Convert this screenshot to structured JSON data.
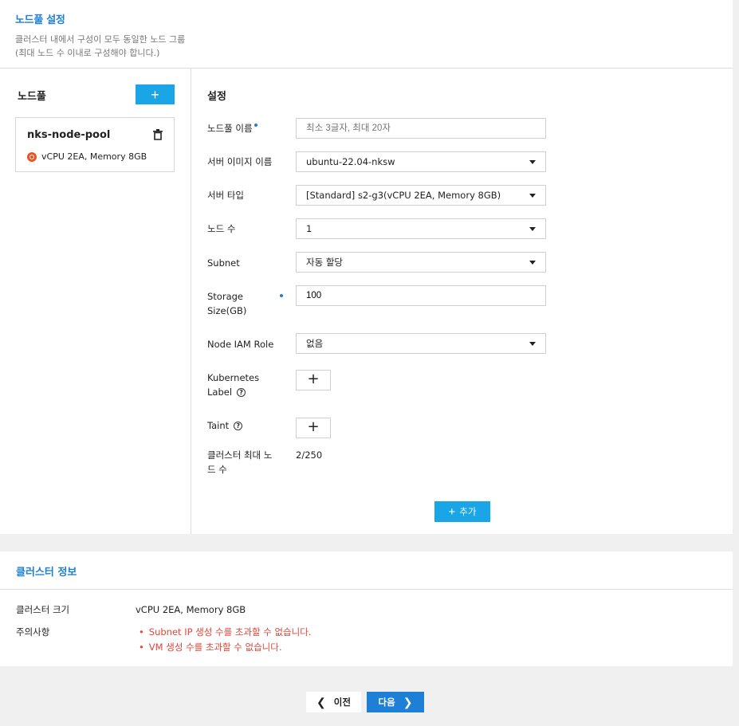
{
  "header": {
    "title": "노드풀 설정",
    "desc_line1": "클러스터 내에서 구성이 모두 동일한 노드 그룹",
    "desc_line2": "(최대 노드 수 이내로 구성해야 합니다.)"
  },
  "nodepool_panel": {
    "title": "노드풀",
    "add_label": "+",
    "pools": [
      {
        "name": "nks-node-pool",
        "spec": "vCPU 2EA, Memory 8GB",
        "os_icon": "ubuntu-icon"
      }
    ]
  },
  "settings": {
    "title": "설정",
    "nodepool_name": {
      "label": "노드풀 이름",
      "placeholder": "최소 3글자, 최대 20자"
    },
    "server_image": {
      "label": "서버 이미지 이름",
      "value": "ubuntu-22.04-nksw"
    },
    "server_type": {
      "label": "서버 타입",
      "value": "[Standard] s2-g3(vCPU 2EA, Memory 8GB)"
    },
    "node_count": {
      "label": "노드 수",
      "value": "1"
    },
    "subnet": {
      "label": "Subnet",
      "value": "자동 할당"
    },
    "storage": {
      "label_line1": "Storage",
      "label_line2": "Size(GB)",
      "value": "100"
    },
    "iam_role": {
      "label": "Node IAM Role",
      "value": "없음"
    },
    "k8s_label": {
      "label_line1": "Kubernetes",
      "label_line2": "Label",
      "add": "+"
    },
    "taint": {
      "label": "Taint",
      "add": "+"
    },
    "max_nodes": {
      "label_line1": "클러스터 최대 노",
      "label_line2": "드 수",
      "value": "2/250"
    },
    "add_button": {
      "icon": "+",
      "label": "추가"
    }
  },
  "cluster_info": {
    "title": "클러스터 정보",
    "size_label": "클러스터 크기",
    "size_value": "vCPU 2EA, Memory 8GB",
    "notice_label": "주의사항",
    "warnings": [
      "Subnet IP 생성 수를 초과할 수 없습니다.",
      "VM 생성 수를 초과할 수 없습니다."
    ]
  },
  "nav": {
    "prev": "이전",
    "next": "다음"
  },
  "colors": {
    "accent": "#1d7fd6",
    "button": "#1aa5e6",
    "warning": "#e0453a"
  }
}
